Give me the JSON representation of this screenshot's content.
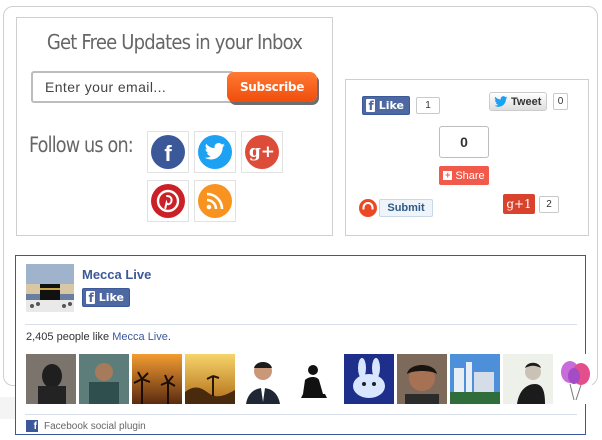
{
  "subscribe": {
    "title": "Get Free Updates in your Inbox",
    "email_placeholder": "Enter your email...",
    "button_label": "Subscribe",
    "follow_label": "Follow us on:",
    "social_icons": [
      "facebook-icon",
      "twitter-icon",
      "google-plus-icon",
      "pinterest-icon",
      "rss-icon"
    ],
    "google_plus_glyph": "g+"
  },
  "share": {
    "fb_like_label": "Like",
    "fb_like_count": "1",
    "tweet_label": "Tweet",
    "tweet_count": "0",
    "share_count": "0",
    "share_label": "Share",
    "stumble_submit_label": "Submit",
    "gplus_label": "g+1",
    "gplus_count": "2"
  },
  "facebook_plugin": {
    "page_name": "Mecca Live",
    "like_label": "Like",
    "people_count_text": "2,405 people like ",
    "people_page_link": "Mecca Live",
    "people_suffix": ".",
    "footer_text": "Facebook social plugin"
  },
  "colors": {
    "facebook": "#3b5998",
    "twitter": "#1da1f2",
    "google_plus": "#dd4b39",
    "pinterest": "#cb2027",
    "rss": "#f7931e",
    "subscribe_button": "#f15a1a"
  }
}
